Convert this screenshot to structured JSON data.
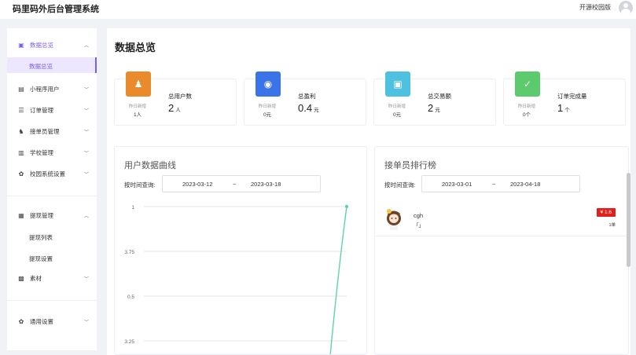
{
  "app": {
    "title": "码里码外后台管理系统",
    "school": "开源校园版"
  },
  "sidebar": {
    "groups": [
      {
        "label": "数据总览",
        "icon": "dashboard-icon",
        "sub": [
          "数据总览"
        ]
      },
      {
        "label": "小程序用户",
        "icon": "user-icon"
      },
      {
        "label": "订单管理",
        "icon": "order-icon"
      },
      {
        "label": "接单员管理",
        "icon": "courier-icon"
      },
      {
        "label": "学校管理",
        "icon": "school-icon"
      },
      {
        "label": "校园系统设置",
        "icon": "gear-icon"
      },
      {
        "label": "提现管理",
        "icon": "wallet-icon",
        "sub": [
          "提现列表",
          "提现设置"
        ]
      },
      {
        "label": "素材",
        "icon": "media-icon"
      },
      {
        "label": "通用设置",
        "icon": "gear-icon"
      }
    ]
  },
  "main": {
    "title": "数据总览",
    "stats": [
      {
        "label": "总用户数",
        "value": "2",
        "unit": "人",
        "yesterday_label": "昨日新增",
        "yesterday_value": "1人",
        "color": "#e98a2c",
        "icon": "user-icon"
      },
      {
        "label": "总盈利",
        "value": "0.4",
        "unit": "元",
        "yesterday_label": "昨日新增",
        "yesterday_value": "0元",
        "color": "#3b73e8",
        "icon": "moneybag-icon"
      },
      {
        "label": "总交易额",
        "value": "2",
        "unit": "元",
        "yesterday_label": "昨日新增",
        "yesterday_value": "0元",
        "color": "#4ec1e0",
        "icon": "wallet-icon"
      },
      {
        "label": "订单完成量",
        "value": "1",
        "unit": "个",
        "yesterday_label": "昨日新增",
        "yesterday_value": "0个",
        "color": "#5ccb6e",
        "icon": "check-clipboard-icon"
      }
    ],
    "user_chart": {
      "title": "用户数据曲线",
      "query_label": "按时间查询:",
      "start": "2023-03-12",
      "sep": "~",
      "end": "2023-03-18"
    },
    "ranking": {
      "title": "接单员排行榜",
      "query_label": "按时间查询:",
      "start": "2023-03-01",
      "sep": "~",
      "end": "2023-04-18",
      "items": [
        {
          "name": "cgh",
          "sub": "「」",
          "amount": "¥ 1.6",
          "count": "1单"
        }
      ]
    }
  },
  "chart_data": {
    "type": "line",
    "title": "",
    "xlabel": "",
    "ylabel": "",
    "y_ticks": [
      "1",
      "3.75",
      "0.5",
      "3.25"
    ],
    "series": [
      {
        "values": [
          0,
          0,
          0,
          0,
          0,
          0,
          1
        ]
      }
    ],
    "color": "#5fd3a8"
  }
}
